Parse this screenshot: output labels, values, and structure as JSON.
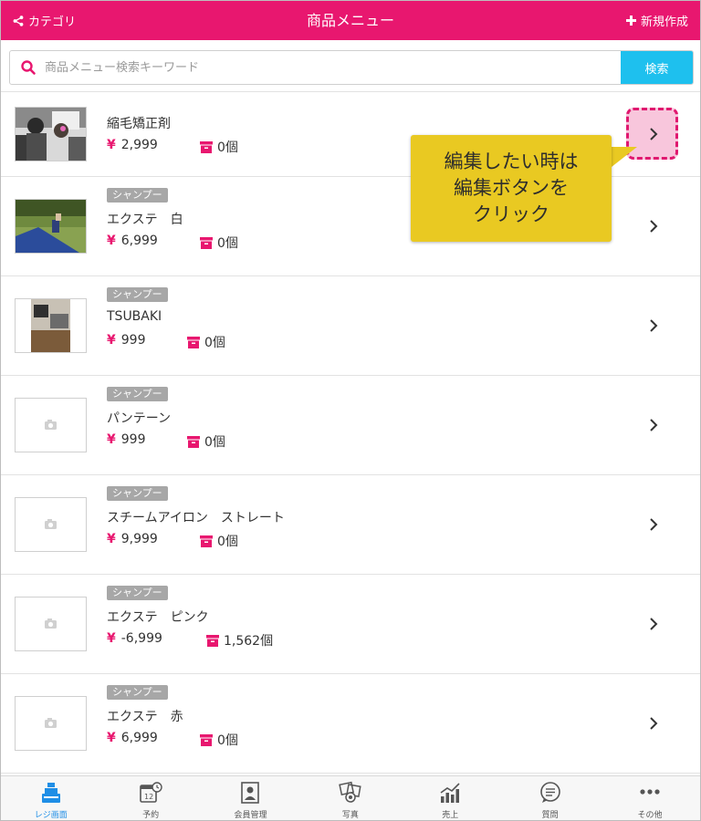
{
  "header": {
    "left_label": "カテゴリ",
    "title": "商品メニュー",
    "right_label": "新規作成"
  },
  "search": {
    "placeholder": "商品メニュー検索キーワード",
    "button_label": "検索"
  },
  "items": [
    {
      "category": "",
      "name": "縮毛矯正剤",
      "price": "2,999",
      "stock": "0個",
      "has_photo": true
    },
    {
      "category": "シャンプー",
      "name": "エクステ　白",
      "price": "6,999",
      "stock": "0個",
      "has_photo": true
    },
    {
      "category": "シャンプー",
      "name": "TSUBAKI",
      "price": "999",
      "stock": "0個",
      "has_photo": true
    },
    {
      "category": "シャンプー",
      "name": "パンテーン",
      "price": "999",
      "stock": "0個",
      "has_photo": false
    },
    {
      "category": "シャンプー",
      "name": "スチームアイロン　ストレート",
      "price": "9,999",
      "stock": "0個",
      "has_photo": false
    },
    {
      "category": "シャンプー",
      "name": "エクステ　ピンク",
      "price": "-6,999",
      "stock": "1,562個",
      "has_photo": false
    },
    {
      "category": "シャンプー",
      "name": "エクステ　赤",
      "price": "6,999",
      "stock": "0個",
      "has_photo": false
    }
  ],
  "currency_symbol": "¥",
  "callout": {
    "line1": "編集したい時は",
    "line2": "編集ボタンを",
    "line3": "クリック"
  },
  "tabs": [
    {
      "label": "レジ画面",
      "icon": "register-icon",
      "active": true
    },
    {
      "label": "予約",
      "icon": "calendar-icon",
      "active": false
    },
    {
      "label": "会員管理",
      "icon": "member-icon",
      "active": false
    },
    {
      "label": "写真",
      "icon": "photo-icon",
      "active": false
    },
    {
      "label": "売上",
      "icon": "sales-chart-icon",
      "active": false
    },
    {
      "label": "質問",
      "icon": "chat-icon",
      "active": false
    },
    {
      "label": "その他",
      "icon": "more-icon",
      "active": false
    }
  ],
  "colors": {
    "brand": "#e8176f",
    "search_button": "#1ec0ee",
    "badge": "#a7a7a7",
    "callout": "#e9c922",
    "active_tab": "#1f8ee6"
  }
}
